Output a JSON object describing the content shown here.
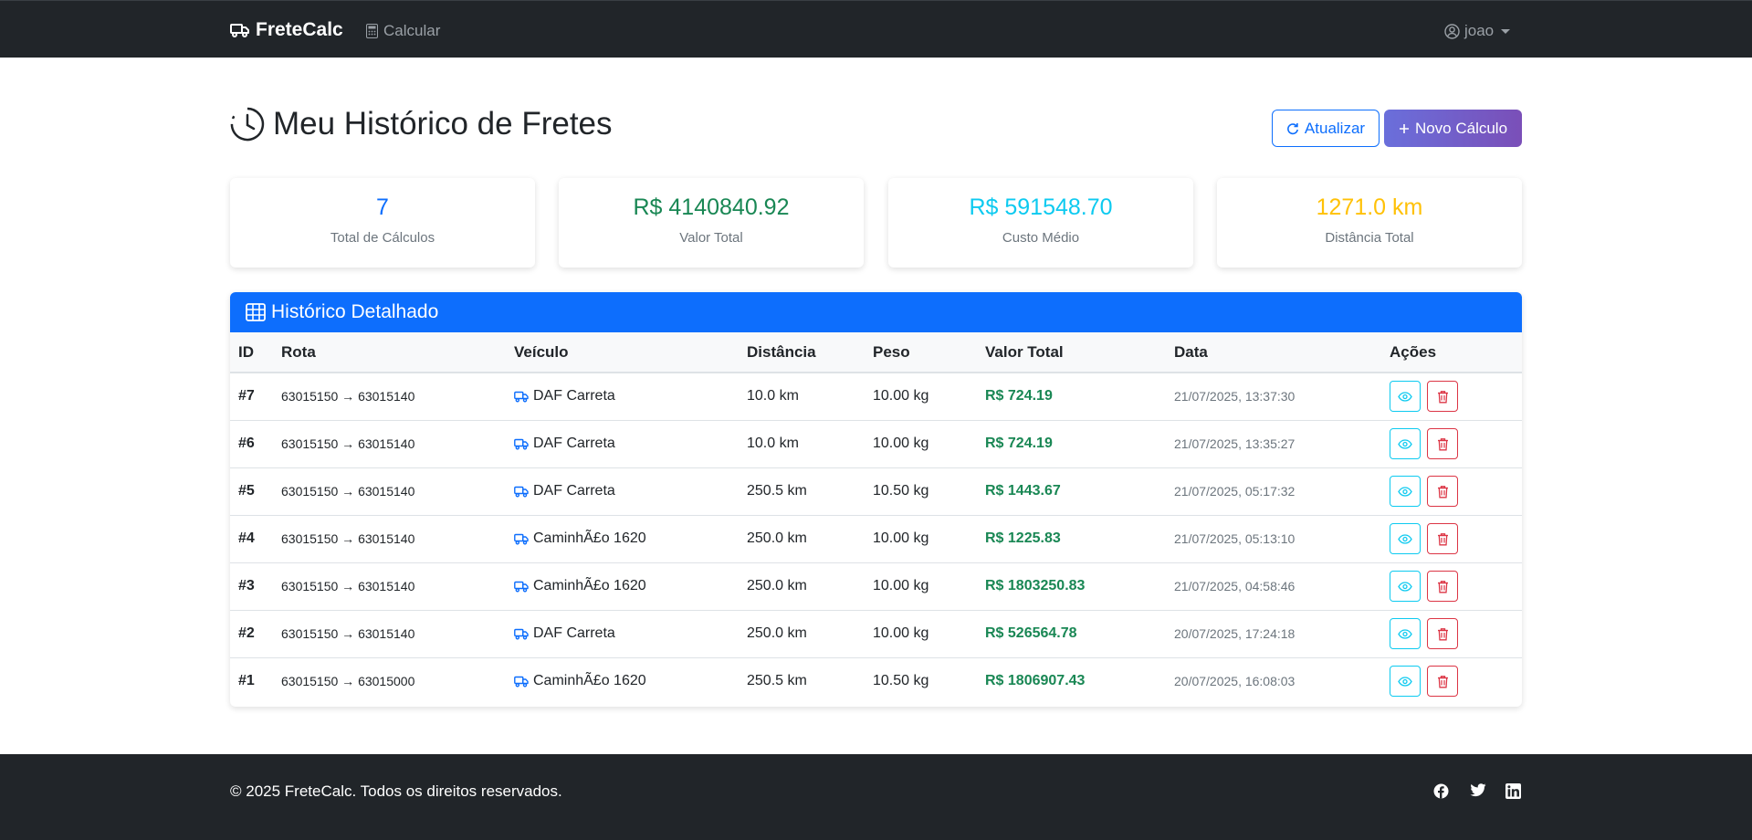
{
  "navbar": {
    "brand": "FreteCalc",
    "calc_link": "Calcular",
    "user": "joao"
  },
  "header": {
    "title": "Meu Histórico de Fretes",
    "refresh_label": "Atualizar",
    "new_label": "Novo Cálculo"
  },
  "stats": [
    {
      "value": "7",
      "label": "Total de Cálculos",
      "color": "#0d6efd"
    },
    {
      "value": "R$ 4140840.92",
      "label": "Valor Total",
      "color": "#198754"
    },
    {
      "value": "R$ 591548.70",
      "label": "Custo Médio",
      "color": "#0dcaf0"
    },
    {
      "value": "1271.0 km",
      "label": "Distância Total",
      "color": "#ffc107"
    }
  ],
  "history": {
    "title": "Histórico Detalhado",
    "columns": [
      "ID",
      "Rota",
      "Veículo",
      "Distância",
      "Peso",
      "Valor Total",
      "Data",
      "Ações"
    ],
    "rows": [
      {
        "id": "#7",
        "rota": "63015150 → 63015140",
        "veiculo": "DAF Carreta",
        "distancia": "10.0 km",
        "peso": "10.00 kg",
        "valor": "R$ 724.19",
        "data": "21/07/2025, 13:37:30"
      },
      {
        "id": "#6",
        "rota": "63015150 → 63015140",
        "veiculo": "DAF Carreta",
        "distancia": "10.0 km",
        "peso": "10.00 kg",
        "valor": "R$ 724.19",
        "data": "21/07/2025, 13:35:27"
      },
      {
        "id": "#5",
        "rota": "63015150 → 63015140",
        "veiculo": "DAF Carreta",
        "distancia": "250.5 km",
        "peso": "10.50 kg",
        "valor": "R$ 1443.67",
        "data": "21/07/2025, 05:17:32"
      },
      {
        "id": "#4",
        "rota": "63015150 → 63015140",
        "veiculo": "CaminhÃ£o 1620",
        "distancia": "250.0 km",
        "peso": "10.00 kg",
        "valor": "R$ 1225.83",
        "data": "21/07/2025, 05:13:10"
      },
      {
        "id": "#3",
        "rota": "63015150 → 63015140",
        "veiculo": "CaminhÃ£o 1620",
        "distancia": "250.0 km",
        "peso": "10.00 kg",
        "valor": "R$ 1803250.83",
        "data": "21/07/2025, 04:58:46"
      },
      {
        "id": "#2",
        "rota": "63015150 → 63015140",
        "veiculo": "DAF Carreta",
        "distancia": "250.0 km",
        "peso": "10.00 kg",
        "valor": "R$ 526564.78",
        "data": "20/07/2025, 17:24:18"
      },
      {
        "id": "#1",
        "rota": "63015150 → 63015000",
        "veiculo": "CaminhÃ£o 1620",
        "distancia": "250.5 km",
        "peso": "10.50 kg",
        "valor": "R$ 1806907.43",
        "data": "20/07/2025, 16:08:03"
      }
    ]
  },
  "footer": {
    "copyright": "© 2025 FreteCalc. Todos os direitos reservados.",
    "social_icons": [
      "facebook-icon",
      "twitter-icon",
      "linkedin-icon"
    ]
  }
}
